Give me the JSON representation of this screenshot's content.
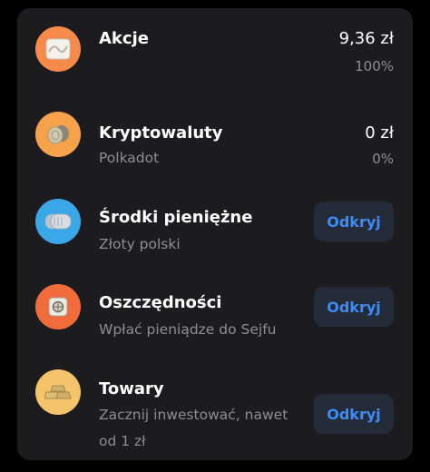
{
  "items": [
    {
      "title": "Akcje",
      "value": "9,36 zł",
      "percent": "100%",
      "icon": "stock-chart-icon",
      "icon_color": "#f58a4b"
    },
    {
      "title": "Kryptowaluty",
      "subtitle": "Polkadot",
      "value": "0 zł",
      "percent": "0%",
      "icon": "crypto-coins-icon",
      "icon_color": "#f5a24b"
    },
    {
      "title": "Środki pieniężne",
      "subtitle": "Złoty polski",
      "button": "Odkryj",
      "icon": "cash-coins-icon",
      "icon_color": "#3aa8e8"
    },
    {
      "title": "Oszczędności",
      "subtitle": "Wpłać pieniądze do Sejfu",
      "button": "Odkryj",
      "icon": "safe-icon",
      "icon_color": "#f26b3a"
    },
    {
      "title": "Towary",
      "subtitle_line1": "Zacznij inwestować, nawet",
      "subtitle_line2": "od 1 zł",
      "button": "Odkryj",
      "icon": "gold-bars-icon",
      "icon_color": "#f5c46a"
    }
  ],
  "colors": {
    "background": "#000000",
    "card": "#1c1c1e",
    "button_bg": "#242b38",
    "accent": "#3d8bf7",
    "muted_text": "#8e8e93"
  }
}
